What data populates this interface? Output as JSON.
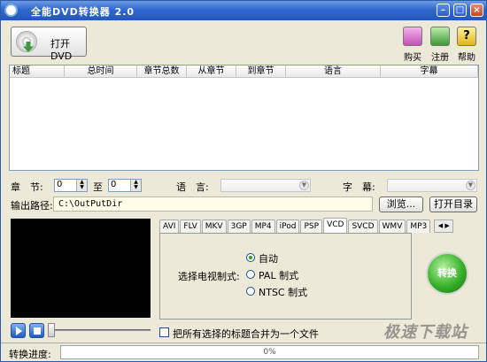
{
  "window": {
    "title": "全能DVD转换器 2.0"
  },
  "toolbar": {
    "open_label": "打开DVD",
    "buy_label": "购买",
    "register_label": "注册",
    "help_label": "帮助"
  },
  "grid": {
    "headers": [
      "标题",
      "总时间",
      "章节总数",
      "从章节",
      "到章节",
      "语言",
      "字幕"
    ]
  },
  "options": {
    "chapter_label": "章　节:",
    "chapter_from": "0",
    "to_label": "至",
    "chapter_to": "0",
    "language_label": "语　言:",
    "subtitle_label": "字　幕:"
  },
  "output": {
    "label": "输出路径:",
    "path": "C:\\OutPutDir",
    "browse_label": "浏览...",
    "open_dir_label": "打开目录"
  },
  "formats": {
    "tabs": [
      "AVI",
      "FLV",
      "MKV",
      "3GP",
      "MP4",
      "iPod",
      "PSP",
      "VCD",
      "SVCD",
      "WMV",
      "MP3"
    ],
    "active_tab": "VCD",
    "tv_standard_label": "选择电视制式:",
    "radio_auto": "自动",
    "radio_pal": "PAL 制式",
    "radio_ntsc": "NTSC 制式",
    "selected": "auto"
  },
  "convert_label": "转换",
  "merge_label": "把所有选择的标题合并为一个文件",
  "status": {
    "progress_label": "转换进度:",
    "progress_text": "0%",
    "progress_value": 0
  },
  "watermark": "极速下载站",
  "colors": {
    "titlebar": "#2f68d0",
    "convert_green": "#37b12a"
  }
}
